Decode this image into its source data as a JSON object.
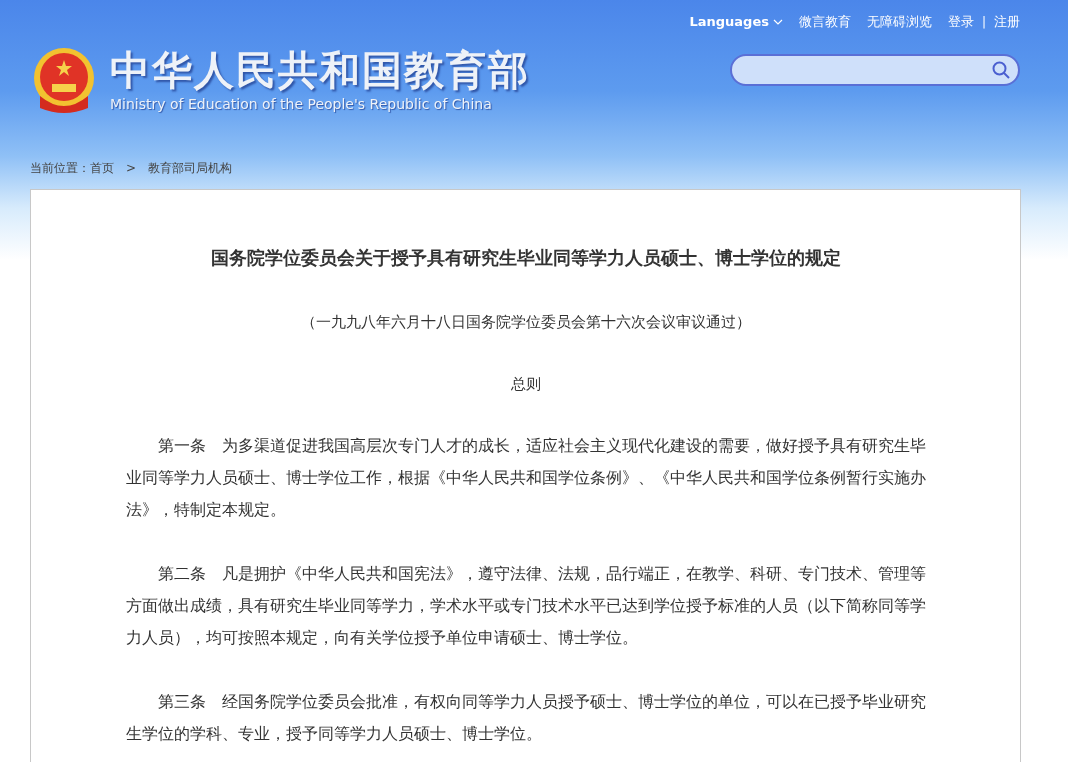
{
  "top_links": [
    {
      "label": "Languages",
      "kind": "dropdown"
    },
    {
      "label": "微言教育",
      "kind": "link"
    },
    {
      "label": "无障碍浏览",
      "kind": "link"
    },
    {
      "label": "登录",
      "kind": "link"
    },
    {
      "label": "|",
      "kind": "separator"
    },
    {
      "label": "注册",
      "kind": "link"
    }
  ],
  "site": {
    "title": "中华人民共和国教育部",
    "subtitle": "Ministry of Education of the People's Republic of China"
  },
  "breadcrumb": {
    "label": "当前位置：",
    "items": [
      "首页",
      "教育部司局机构"
    ],
    "separator": ">"
  },
  "article": {
    "title": "国务院学位委员会关于授予具有研究生毕业同等学力人员硕士、博士学位的规定",
    "note": "（一九九八年六月十八日国务院学位委员会第十六次会议审议通过）",
    "section": "总则",
    "paragraphs": [
      {
        "label": "第一条",
        "text": "为多渠道促进我国高层次专门人才的成长，适应社会主义现代化建设的需要，做好授予具有研究生毕业同等学力人员硕士、博士学位工作，根据《中华人民共和国学位条例》、《中华人民共和国学位条例暂行实施办法》，特制定本规定。"
      },
      {
        "label": "第二条",
        "text": "凡是拥护《中华人民共和国宪法》，遵守法律、法规，品行端正，在教学、科研、专门技术、管理等方面做出成绩，具有研究生毕业同等学力，学术水平或专门技术水平已达到学位授予标准的人员（以下简称同等学力人员），均可按照本规定，向有关学位授予单位申请硕士、博士学位。"
      },
      {
        "label": "第三条",
        "text": "经国务院学位委员会批准，有权向同等学力人员授予硕士、博士学位的单位，可以在已授予毕业研究生学位的学科、专业，授予同等学力人员硕士、博士学位。"
      }
    ]
  }
}
